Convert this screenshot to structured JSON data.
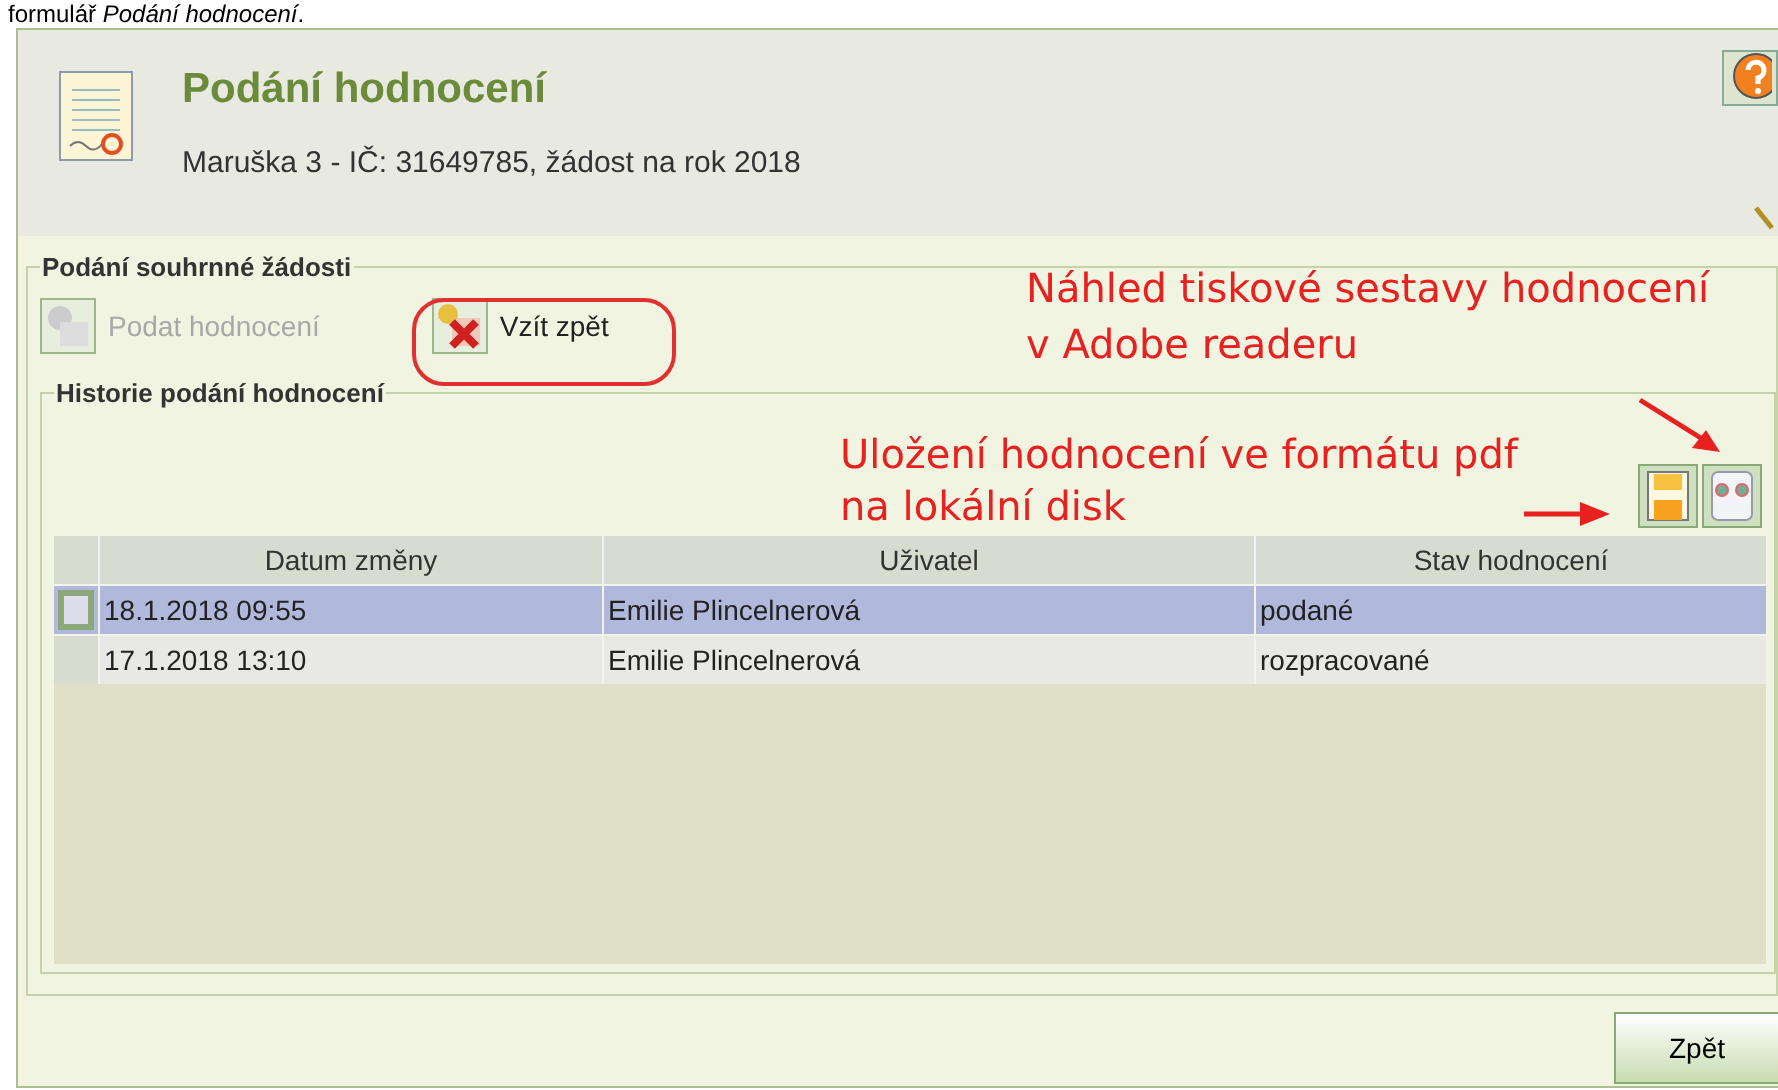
{
  "doc_text": "formulář *Podání hodnocení*.",
  "header": {
    "title": "Podání hodnocení",
    "subtitle": "Maruška 3 - IČ: 31649785, žádost na rok 2018"
  },
  "summary_group": {
    "legend": "Podání souhrnné žádosti",
    "buttons": [
      {
        "label": "Podat hodnocení",
        "disabled": true,
        "kind": "submit"
      },
      {
        "label": "Vzít zpět",
        "disabled": false,
        "kind": "withdraw"
      }
    ]
  },
  "history_group": {
    "legend": "Historie podání hodnocení",
    "table": {
      "columns": [
        "Datum změny",
        "Uživatel",
        "Stav hodnocení"
      ],
      "rows": [
        {
          "cells": [
            "18.1.2018 09:55",
            "Emilie Plincelnerová",
            "podané"
          ],
          "selected": true
        },
        {
          "cells": [
            "17.1.2018 13:10",
            "Emilie Plincelnerová",
            "rozpracované"
          ],
          "selected": false
        }
      ]
    }
  },
  "annotations": [
    {
      "text": "Náhled tiskové sestavy hodnocení\nv Adobe readeru"
    },
    {
      "text": "Uložení hodnocení ve formátu pdf\nna lokální disk"
    }
  ],
  "footer": {
    "button": "Zpět"
  }
}
